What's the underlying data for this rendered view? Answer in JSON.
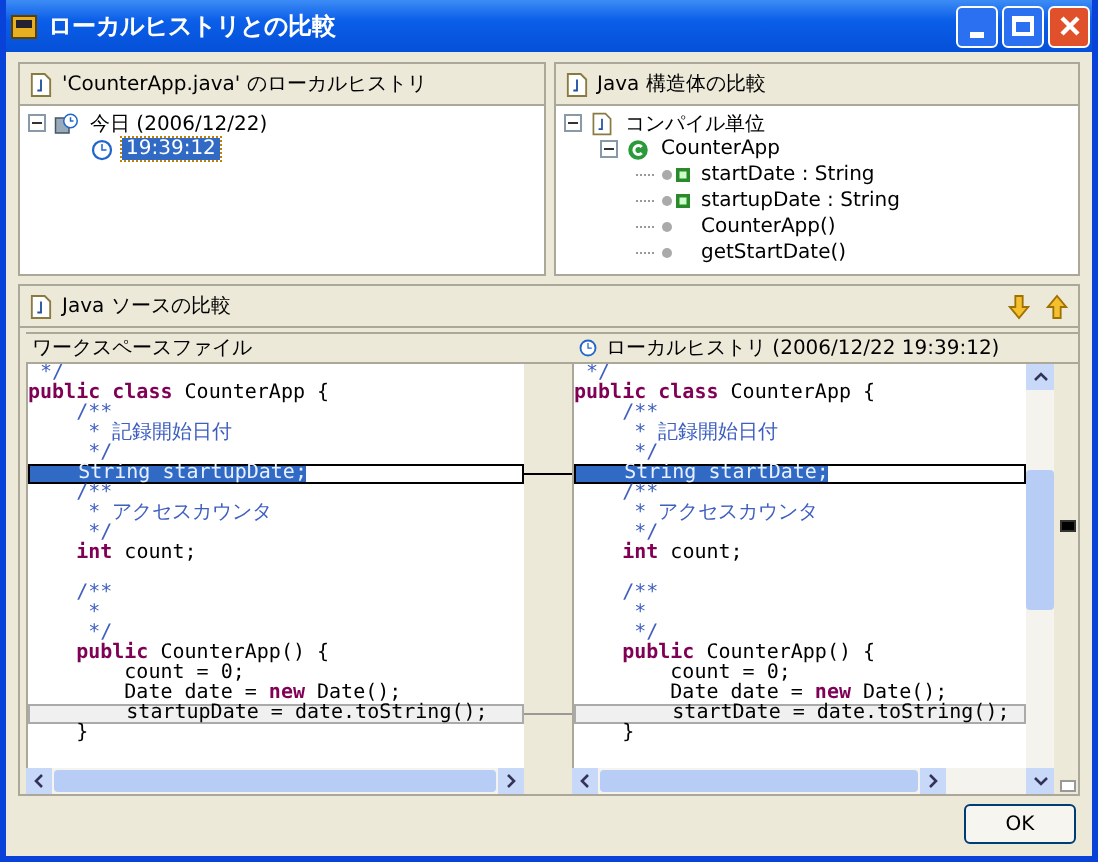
{
  "window": {
    "title": "ローカルヒストリとの比較"
  },
  "history_panel": {
    "title": "'CounterApp.java' のローカルヒストリ",
    "tree": [
      {
        "label": "今日 (2006/12/22)",
        "kind": "day",
        "expanded": true,
        "selected": false,
        "children": [
          {
            "label": "19:39:12",
            "kind": "entry",
            "selected": true
          }
        ]
      }
    ]
  },
  "structure_panel": {
    "title": "Java 構造体の比較",
    "tree": [
      {
        "label": "コンパイル単位",
        "kind": "unit",
        "expanded": true,
        "children": [
          {
            "label": "CounterApp",
            "kind": "class",
            "expanded": true,
            "children": [
              {
                "label": "startDate : String",
                "kind": "field"
              },
              {
                "label": "startupDate : String",
                "kind": "field"
              },
              {
                "label": "CounterApp()",
                "kind": "method"
              },
              {
                "label": "getStartDate()",
                "kind": "method"
              }
            ]
          }
        ]
      }
    ]
  },
  "source_panel": {
    "title": "Java ソースの比較",
    "left": {
      "header": "ワークスペースファイル",
      "lines": [
        {
          "tokens": [
            {
              "kind": "comment",
              "text": " */"
            }
          ]
        },
        {
          "tokens": [
            {
              "kind": "keyword",
              "text": "public class "
            },
            {
              "kind": "plain",
              "text": "CounterApp {"
            }
          ]
        },
        {
          "tokens": [
            {
              "kind": "comment",
              "text": "    /**"
            }
          ]
        },
        {
          "tokens": [
            {
              "kind": "comment",
              "text": "     * 記録開始日付"
            }
          ]
        },
        {
          "tokens": [
            {
              "kind": "comment",
              "text": "     */"
            }
          ]
        },
        {
          "kind": "selected",
          "tokens": [
            {
              "kind": "plain",
              "text": "    String startupDate;"
            }
          ]
        },
        {
          "tokens": [
            {
              "kind": "comment",
              "text": "    /**"
            }
          ]
        },
        {
          "tokens": [
            {
              "kind": "comment",
              "text": "     * アクセスカウンタ"
            }
          ]
        },
        {
          "tokens": [
            {
              "kind": "comment",
              "text": "     */"
            }
          ]
        },
        {
          "tokens": [
            {
              "kind": "keyword",
              "text": "    int "
            },
            {
              "kind": "plain",
              "text": "count;"
            }
          ]
        },
        {
          "kind": "blank"
        },
        {
          "tokens": [
            {
              "kind": "comment",
              "text": "    /**"
            }
          ]
        },
        {
          "tokens": [
            {
              "kind": "comment",
              "text": "     *"
            }
          ]
        },
        {
          "tokens": [
            {
              "kind": "comment",
              "text": "     */"
            }
          ]
        },
        {
          "tokens": [
            {
              "kind": "keyword",
              "text": "    public "
            },
            {
              "kind": "plain",
              "text": "CounterApp() {"
            }
          ]
        },
        {
          "tokens": [
            {
              "kind": "plain",
              "text": "        count = 0;"
            }
          ]
        },
        {
          "tokens": [
            {
              "kind": "plain",
              "text": "        Date date = "
            },
            {
              "kind": "keyword",
              "text": "new "
            },
            {
              "kind": "plain",
              "text": "Date();"
            }
          ]
        },
        {
          "kind": "changed",
          "tokens": [
            {
              "kind": "plain",
              "text": "        startupDate = date.toString();"
            }
          ]
        },
        {
          "tokens": [
            {
              "kind": "plain",
              "text": "    }"
            }
          ]
        }
      ]
    },
    "right": {
      "header": "ローカルヒストリ (2006/12/22 19:39:12)",
      "lines": [
        {
          "tokens": [
            {
              "kind": "comment",
              "text": " */"
            }
          ]
        },
        {
          "tokens": [
            {
              "kind": "keyword",
              "text": "public class "
            },
            {
              "kind": "plain",
              "text": "CounterApp {"
            }
          ]
        },
        {
          "tokens": [
            {
              "kind": "comment",
              "text": "    /**"
            }
          ]
        },
        {
          "tokens": [
            {
              "kind": "comment",
              "text": "     * 記録開始日付"
            }
          ]
        },
        {
          "tokens": [
            {
              "kind": "comment",
              "text": "     */"
            }
          ]
        },
        {
          "kind": "selected",
          "tokens": [
            {
              "kind": "plain",
              "text": "    String startDate;"
            }
          ]
        },
        {
          "tokens": [
            {
              "kind": "comment",
              "text": "    /**"
            }
          ]
        },
        {
          "tokens": [
            {
              "kind": "comment",
              "text": "     * アクセスカウンタ"
            }
          ]
        },
        {
          "tokens": [
            {
              "kind": "comment",
              "text": "     */"
            }
          ]
        },
        {
          "tokens": [
            {
              "kind": "keyword",
              "text": "    int "
            },
            {
              "kind": "plain",
              "text": "count;"
            }
          ]
        },
        {
          "kind": "blank"
        },
        {
          "tokens": [
            {
              "kind": "comment",
              "text": "    /**"
            }
          ]
        },
        {
          "tokens": [
            {
              "kind": "comment",
              "text": "     *"
            }
          ]
        },
        {
          "tokens": [
            {
              "kind": "comment",
              "text": "     */"
            }
          ]
        },
        {
          "tokens": [
            {
              "kind": "keyword",
              "text": "    public "
            },
            {
              "kind": "plain",
              "text": "CounterApp() {"
            }
          ]
        },
        {
          "tokens": [
            {
              "kind": "plain",
              "text": "        count = 0;"
            }
          ]
        },
        {
          "tokens": [
            {
              "kind": "plain",
              "text": "        Date date = "
            },
            {
              "kind": "keyword",
              "text": "new "
            },
            {
              "kind": "plain",
              "text": "Date();"
            }
          ]
        },
        {
          "kind": "changed",
          "tokens": [
            {
              "kind": "plain",
              "text": "        startDate = date.toString();"
            }
          ]
        },
        {
          "tokens": [
            {
              "kind": "plain",
              "text": "    }"
            }
          ]
        }
      ]
    }
  },
  "buttons": [
    {
      "label": "OK"
    }
  ]
}
